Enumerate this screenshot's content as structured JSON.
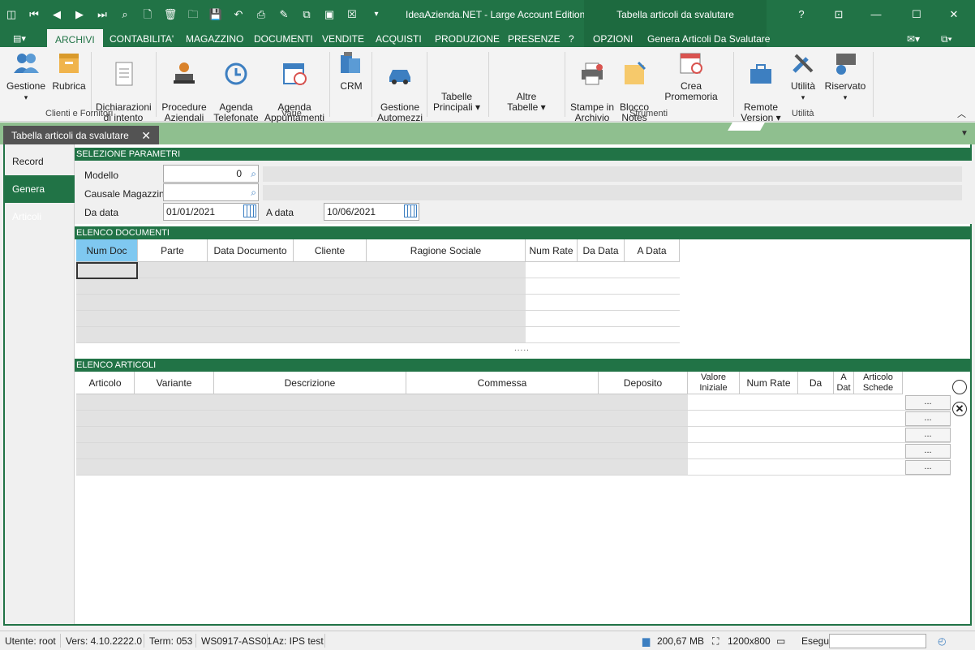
{
  "app": {
    "title": "IdeaAzienda.NET - Large Account Edition",
    "context_title": "Tabella articoli da svalutare",
    "help": "?"
  },
  "menu": {
    "tabs": [
      "ARCHIVI",
      "CONTABILITA'",
      "MAGAZZINO",
      "DOCUMENTI",
      "VENDITE",
      "ACQUISTI",
      "PRODUZIONE",
      "PRESENZE",
      "?"
    ],
    "context_tabs": [
      "OPZIONI",
      "Genera Articoli Da Svalutare"
    ]
  },
  "ribbon": {
    "buttons": [
      {
        "label": "Gestione",
        "dropdown": true
      },
      {
        "label": "Rubrica"
      },
      {
        "label": "Dichiarazioni\ndi intento"
      },
      {
        "label": "Procedure\nAziendali"
      },
      {
        "label": "Agenda\nTelefonate"
      },
      {
        "label": "Agenda\nAppuntamenti"
      },
      {
        "label": "CRM"
      },
      {
        "label": "Gestione\nAutomezzi"
      },
      {
        "label": "Tabelle\nPrincipali ▾"
      },
      {
        "label": "Altre\nTabelle ▾"
      },
      {
        "label": "Stampe in\nArchivio"
      },
      {
        "label": "Blocco\nNotes"
      },
      {
        "label": "Crea Promemoria"
      },
      {
        "label": "Remote\nVersion ▾"
      },
      {
        "label": "Utilità",
        "dropdown": true
      },
      {
        "label": "Riservato",
        "dropdown": true
      }
    ],
    "groups": [
      "Clienti e Fornitori",
      "Varie",
      "Strumenti",
      "Utilità"
    ]
  },
  "doc_tab": {
    "label": "Tabella articoli da svalutare",
    "close": "✕"
  },
  "sidebar": {
    "items": [
      "Record",
      "Genera Articoli"
    ]
  },
  "params": {
    "header": "SELEZIONE PARAMETRI",
    "modello_label": "Modello",
    "modello_value": "0",
    "causale_label": "Causale Magazzino",
    "causale_value": "",
    "da_data_label": "Da data",
    "da_data_value": "01/01/2021",
    "a_data_label": "A data",
    "a_data_value": "10/06/2021"
  },
  "documenti": {
    "header": "ELENCO DOCUMENTI",
    "columns": [
      "Num Doc",
      "Parte",
      "Data Documento",
      "Cliente",
      "Ragione Sociale",
      "Num Rate",
      "Da Data",
      "A Data"
    ],
    "splitter": "....."
  },
  "articoli": {
    "header": "ELENCO ARTICOLI",
    "columns": [
      "Articolo",
      "Variante",
      "Descrizione",
      "Commessa",
      "Deposito",
      "Valore\nIniziale",
      "Num Rate",
      "Da Data",
      "A\nDat\ne",
      "Articolo\nSchede"
    ],
    "row_button": "..."
  },
  "status": {
    "utente": "Utente: root",
    "vers": "Vers: 4.10.2222.0",
    "term": "Term: 053",
    "ws": "WS0917-ASS01",
    "az": "Az: IPS test",
    "memory": "200,67 MB",
    "resolution": "1200x800",
    "esegui": "Esegui"
  },
  "colors": {
    "accent": "#217346",
    "tab_bg": "#8fbf8f",
    "header_sel": "#7fc8f0"
  }
}
